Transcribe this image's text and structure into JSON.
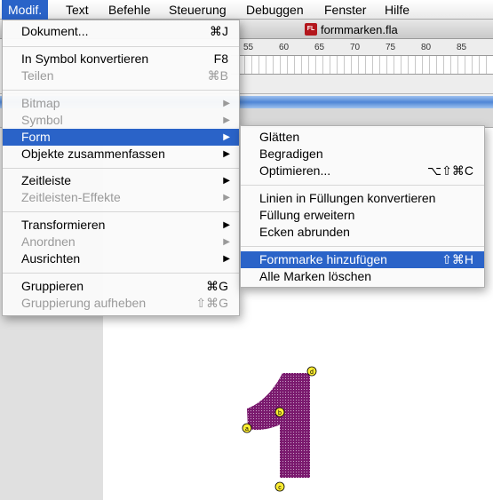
{
  "menubar": {
    "items": [
      {
        "label": "Modif.",
        "active": true
      },
      {
        "label": "Text"
      },
      {
        "label": "Befehle"
      },
      {
        "label": "Steuerung"
      },
      {
        "label": "Debuggen"
      },
      {
        "label": "Fenster"
      },
      {
        "label": "Hilfe"
      }
    ]
  },
  "document": {
    "icon_text": "FL",
    "title": "formmarken.fla"
  },
  "ruler": {
    "ticks": [
      "55",
      "60",
      "65",
      "70",
      "75",
      "80",
      "85"
    ]
  },
  "modify_menu": {
    "items": [
      {
        "label": "Dokument...",
        "shortcut": "⌘J",
        "disabled": false
      },
      {
        "label": "In Symbol konvertieren",
        "shortcut": "F8",
        "disabled": false
      },
      {
        "label": "Teilen",
        "shortcut": "⌘B",
        "disabled": true
      },
      {
        "label": "Bitmap",
        "submenu": true,
        "disabled": true
      },
      {
        "label": "Symbol",
        "submenu": true,
        "disabled": true
      },
      {
        "label": "Form",
        "submenu": true,
        "disabled": false,
        "highlighted": true
      },
      {
        "label": "Objekte zusammenfassen",
        "submenu": true,
        "disabled": false
      },
      {
        "label": "Zeitleiste",
        "submenu": true,
        "disabled": false
      },
      {
        "label": "Zeitleisten-Effekte",
        "submenu": true,
        "disabled": true
      },
      {
        "label": "Transformieren",
        "submenu": true,
        "disabled": false
      },
      {
        "label": "Anordnen",
        "submenu": true,
        "disabled": true
      },
      {
        "label": "Ausrichten",
        "submenu": true,
        "disabled": false
      },
      {
        "label": "Gruppieren",
        "shortcut": "⌘G",
        "disabled": false
      },
      {
        "label": "Gruppierung aufheben",
        "shortcut": "⇧⌘G",
        "disabled": true
      }
    ]
  },
  "form_submenu": {
    "items": [
      {
        "label": "Glätten",
        "shortcut": ""
      },
      {
        "label": "Begradigen",
        "shortcut": ""
      },
      {
        "label": "Optimieren...",
        "shortcut": "⌥⇧⌘C"
      },
      {
        "label": "Linien in Füllungen konvertieren",
        "shortcut": ""
      },
      {
        "label": "Füllung erweitern",
        "shortcut": ""
      },
      {
        "label": "Ecken abrunden",
        "shortcut": ""
      },
      {
        "label": "Formmarke hinzufügen",
        "shortcut": "⇧⌘H",
        "highlighted": true
      },
      {
        "label": "Alle Marken löschen",
        "shortcut": ""
      }
    ]
  },
  "shape_hints": [
    "a",
    "b",
    "c",
    "d"
  ],
  "colors": {
    "menu_highlight": "#2a63c8",
    "shape_fill": "#7a1a6e",
    "hint_fill": "#ffee33"
  },
  "icons": {
    "submenu_arrow": "triangle-right-icon"
  }
}
